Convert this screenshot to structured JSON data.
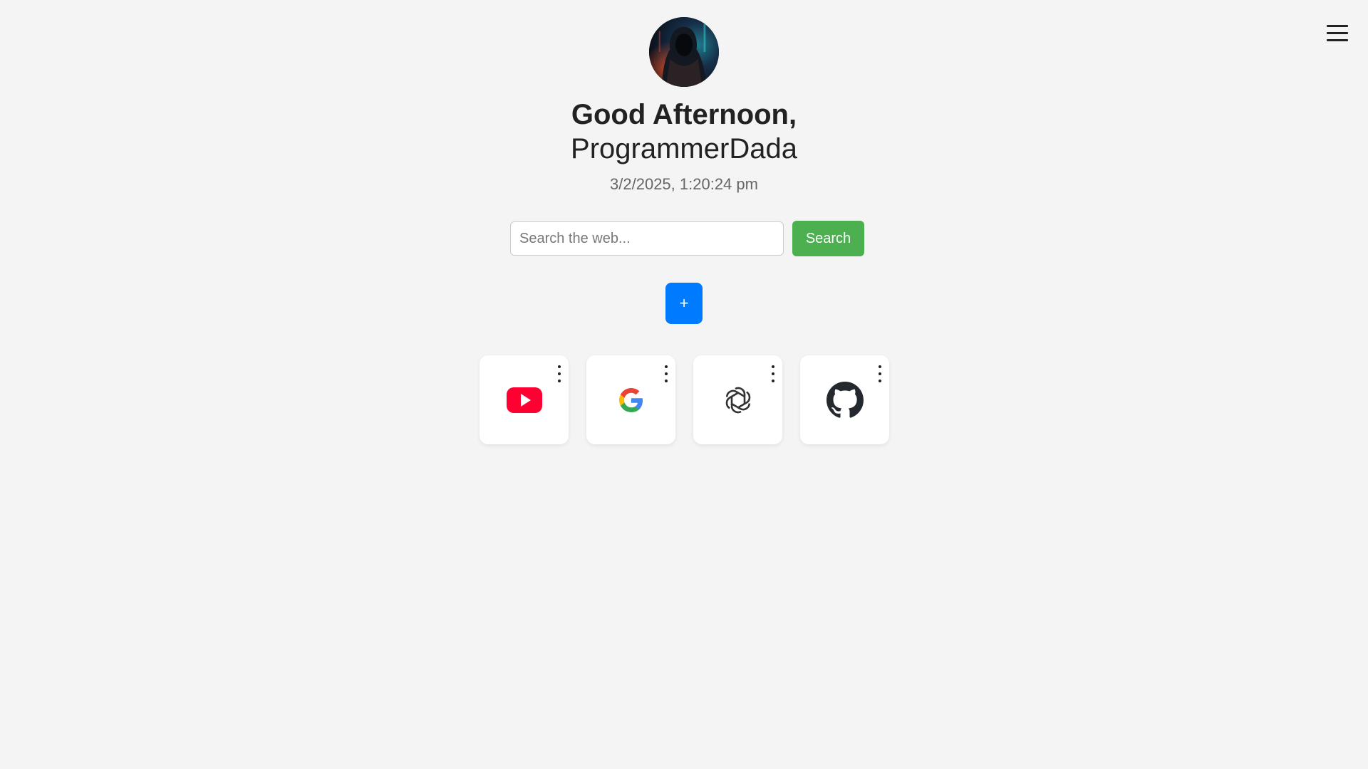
{
  "header": {
    "menu_icon": "hamburger-menu-icon",
    "avatar_icon": "hooded-figure-avatar"
  },
  "greeting": {
    "salutation": "Good Afternoon,",
    "name": "ProgrammerDada",
    "datetime": "3/2/2025, 1:20:24 pm"
  },
  "search": {
    "placeholder": "Search the web...",
    "value": "",
    "button_label": "Search",
    "button_color": "#4caf50"
  },
  "add_shortcut": {
    "label": "+",
    "color": "#007bff"
  },
  "shortcuts": [
    {
      "icon": "youtube-icon",
      "more_icon": "kebab-menu-icon"
    },
    {
      "icon": "google-icon",
      "more_icon": "kebab-menu-icon"
    },
    {
      "icon": "openai-icon",
      "more_icon": "kebab-menu-icon"
    },
    {
      "icon": "github-icon",
      "more_icon": "kebab-menu-icon"
    }
  ],
  "colors": {
    "background": "#f4f4f4",
    "youtube_red": "#ff0033",
    "text": "#222222",
    "muted_text": "#666666"
  }
}
